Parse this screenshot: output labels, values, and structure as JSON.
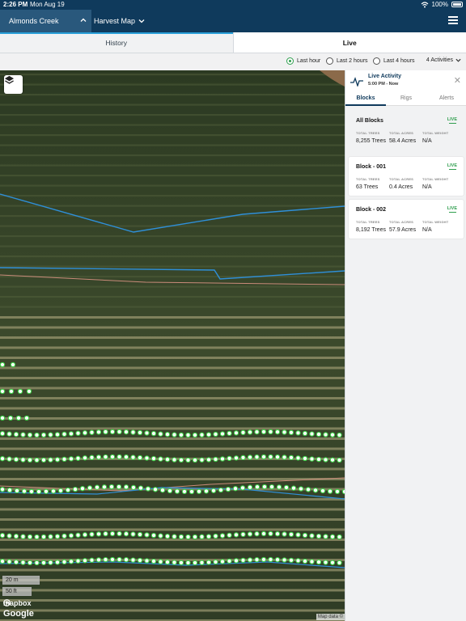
{
  "status": {
    "time": "2:26 PM",
    "date": "Mon Aug 19",
    "battery": "100%"
  },
  "nav": {
    "farm": "Almonds Creek",
    "mode": "Harvest Map"
  },
  "tabs": [
    {
      "label": "History"
    },
    {
      "label": "Live",
      "active": true
    }
  ],
  "filters": {
    "options": [
      {
        "label": "Last hour",
        "selected": true
      },
      {
        "label": "Last 2 hours",
        "selected": false
      },
      {
        "label": "Last 4 hours",
        "selected": false
      }
    ],
    "activities": "4 Activities"
  },
  "map": {
    "scale_m": "20 m",
    "scale_ft": "50 ft",
    "attribution_mapbox": "mapbox",
    "attribution_google": "Google",
    "map_data": "Map data ©"
  },
  "panel": {
    "title": "Live Activity",
    "subtitle": "5:00 PM - Now",
    "tabs": [
      {
        "label": "Blocks",
        "active": true
      },
      {
        "label": "Rigs"
      },
      {
        "label": "Alerts"
      }
    ],
    "headers": {
      "trees": "TOTAL TREES",
      "acres": "TOTAL ACRES",
      "weight": "TOTAL WEIGHT"
    },
    "live_label": "LIVE",
    "blocks": [
      {
        "name": "All Blocks",
        "trees": "8,255 Trees",
        "acres": "58.4 Acres",
        "weight": "N/A"
      },
      {
        "name": "Block - 001",
        "trees": "63 Trees",
        "acres": "0.4 Acres",
        "weight": "N/A"
      },
      {
        "name": "Block - 002",
        "trees": "8,192 Trees",
        "acres": "57.9 Acres",
        "weight": "N/A"
      }
    ]
  },
  "colors": {
    "nav": "#0f3a5c",
    "farm_bg": "#29587c",
    "accent": "#2aa0d9",
    "live": "#2f9e4e",
    "path": "#2f8fd8",
    "boundary": "#c98b7a",
    "tree_dot": "#3fd64a"
  }
}
